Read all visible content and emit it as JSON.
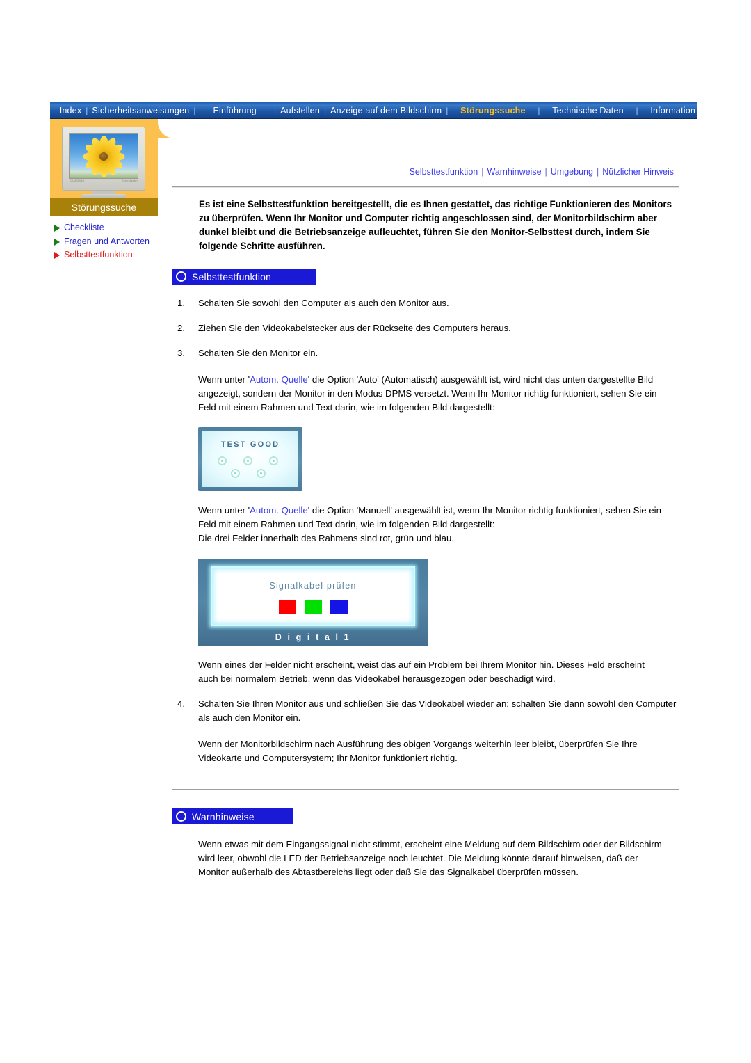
{
  "topnav": {
    "items": [
      {
        "label": "Index",
        "active": false
      },
      {
        "label": "Sicherheitsanweisungen",
        "active": false
      },
      {
        "label": "Einführung",
        "active": false
      },
      {
        "label": "Aufstellen",
        "active": false
      },
      {
        "label": "Anzeige auf dem Bildschirm",
        "active": false
      },
      {
        "label": "Störungssuche",
        "active": true
      },
      {
        "label": "Technische Daten",
        "active": false
      },
      {
        "label": "Information",
        "active": false
      }
    ],
    "separator": "|"
  },
  "sidebar": {
    "title": "Störungssuche",
    "thumbnail_icon": "monitor-sunflower-image",
    "items": [
      {
        "label": "Checkliste",
        "active": false
      },
      {
        "label": "Fragen und Antworten",
        "active": false
      },
      {
        "label": "Selbsttestfunktion",
        "active": true
      }
    ]
  },
  "sublinks": {
    "separator": "|",
    "items": [
      {
        "label": "Selbsttestfunktion"
      },
      {
        "label": "Warnhinweise"
      },
      {
        "label": "Umgebung"
      },
      {
        "label": "Nützlicher Hinweis"
      }
    ]
  },
  "main": {
    "intro": "Es ist eine Selbsttestfunktion bereitgestellt, die es Ihnen gestattet, das richtige Funktionieren des Monitors zu überprüfen. Wenn Ihr Monitor und Computer richtig angeschlossen sind, der Monitorbildschirm aber dunkel bleibt und die Betriebsanzeige aufleuchtet, führen Sie den Monitor-Selbsttest durch, indem Sie folgende Schritte ausführen.",
    "section1": {
      "heading": "Selbsttestfunktion",
      "steps": [
        {
          "num": "1.",
          "text": "Schalten Sie sowohl den Computer als auch den Monitor aus."
        },
        {
          "num": "2.",
          "text": "Ziehen Sie den Videokabelstecker aus der Rückseite des Computers heraus."
        },
        {
          "num": "3.",
          "text": "Schalten Sie den Monitor ein."
        }
      ],
      "para_auto_pre": "Wenn unter '",
      "para_auto_link": "Autom. Quelle",
      "para_auto_post": "' die Option 'Auto' (Automatisch) ausgewählt ist, wird nicht das unten dargestellte Bild angezeigt, sondern der Monitor in den Modus DPMS versetzt. Wenn Ihr Monitor richtig funktioniert, sehen Sie ein Feld mit einem Rahmen und Text darin, wie im folgenden Bild dargestellt:",
      "test_image": {
        "title": "TEST  GOOD",
        "dot_count": 5
      },
      "para_manual_pre": "Wenn unter '",
      "para_manual_link": "Autom. Quelle",
      "para_manual_post": "' die Option 'Manuell' ausgewählt ist, wenn Ihr Monitor richtig funktioniert, sehen Sie ein Feld mit einem Rahmen und Text darin, wie im folgenden Bild dargestellt:",
      "para_manual_colors": "Die drei Felder innerhalb des Rahmens sind rot, grün und blau.",
      "signal_image": {
        "title": "Signalkabel prüfen",
        "footer": "D i g i t a l 1",
        "swatches": [
          "#ff0000",
          "#00e000",
          "#1414e6"
        ]
      },
      "para_missing": "Wenn eines der Felder nicht erscheint, weist das auf ein Problem bei Ihrem Monitor hin. Dieses Feld erscheint auch bei normalem Betrieb, wenn das Videokabel herausgezogen oder beschädigt wird.",
      "step4": {
        "num": "4.",
        "text": "Schalten Sie Ihren Monitor aus und schließen Sie das Videokabel wieder an; schalten Sie dann sowohl den Computer als auch den Monitor ein."
      },
      "para_final": "Wenn der Monitorbildschirm nach Ausführung des obigen Vorgangs weiterhin leer bleibt, überprüfen Sie Ihre Videokarte und Computersystem; Ihr Monitor funktioniert richtig."
    },
    "section2": {
      "heading": "Warnhinweise",
      "para": "Wenn etwas mit dem Eingangssignal nicht stimmt, erscheint eine Meldung auf dem Bildschirm oder der Bildschirm wird leer, obwohl die LED der Betriebsanzeige noch leuchtet. Die Meldung könnte darauf hinweisen, daß der Monitor außerhalb des Abtastbereichs liegt oder daß Sie das Signalkabel überprüfen müssen."
    }
  },
  "colors": {
    "nav_active": "#ffbe20",
    "link_blue": "#3a3aee",
    "sidebar_accent": "#fcc04e",
    "sidebar_title_bg": "#a8810a",
    "section_head_bg": "#1a1ad6",
    "active_item_red": "#e01b1b",
    "inactive_item_blue": "#2222cc"
  }
}
